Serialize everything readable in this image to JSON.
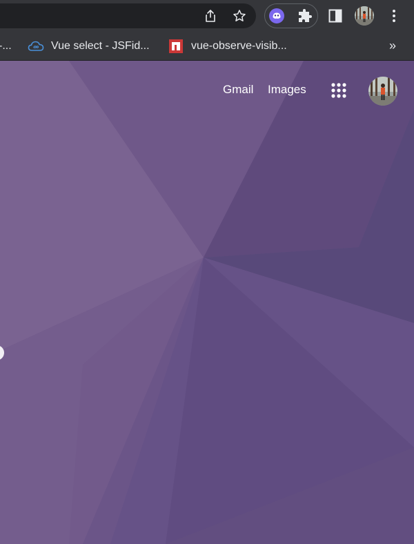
{
  "bookmarks": {
    "items": [
      {
        "label": "-..."
      },
      {
        "label": "Vue select - JSFid...",
        "icon": "cloud-icon"
      },
      {
        "label": "vue-observe-visib...",
        "icon": "npm-icon"
      }
    ],
    "overflow": "»"
  },
  "header": {
    "gmail": "Gmail",
    "images": "Images",
    "apps_icon": "apps-grid-icon"
  },
  "colors": {
    "toolbar": "#35363a",
    "omnibox": "#202124",
    "background": "#6b5585",
    "ext_purple": "#7b68ee",
    "npm_red": "#cb3837",
    "jsfiddle_blue": "#4a90d9"
  }
}
